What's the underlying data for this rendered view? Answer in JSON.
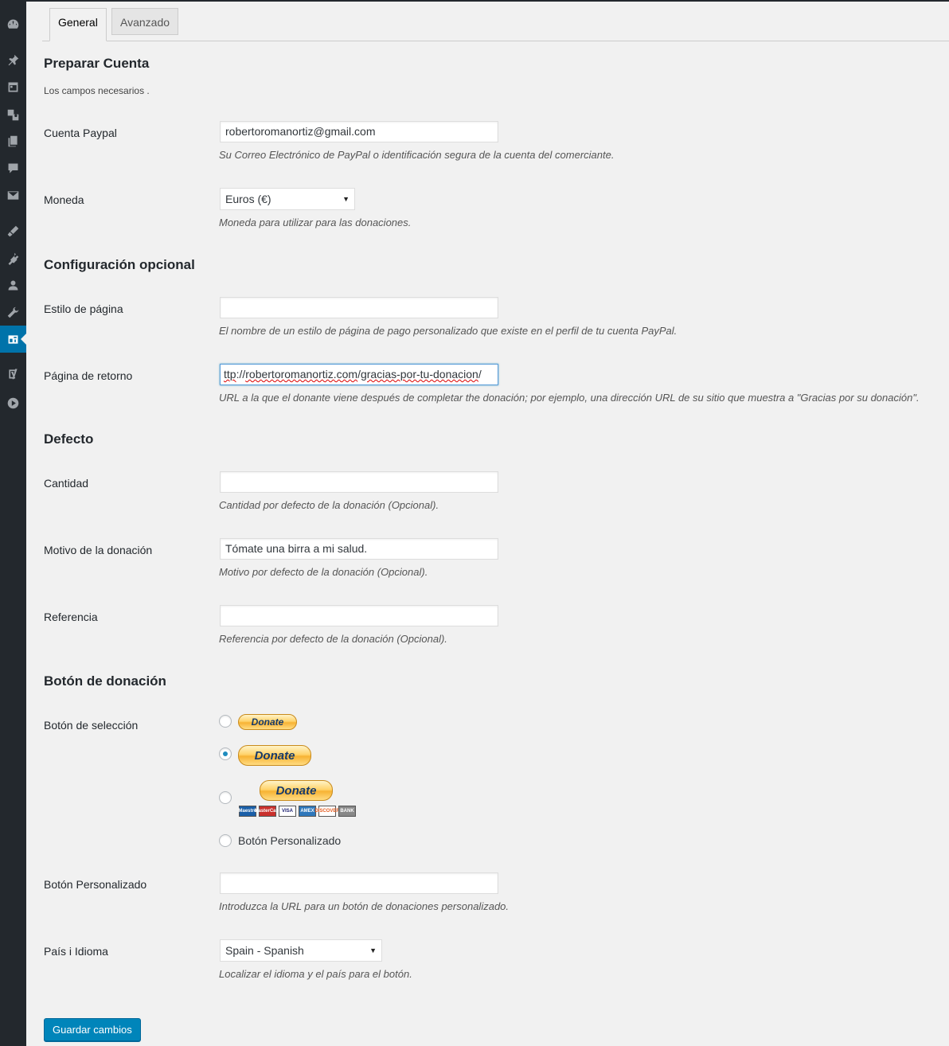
{
  "tabs": {
    "general": "General",
    "advanced": "Avanzado"
  },
  "sidebar": {
    "icons": [
      "dashboard-icon",
      "pin-icon",
      "calendar-icon",
      "media-icon",
      "pages-icon",
      "comments-icon",
      "mail-icon",
      "appearance-icon",
      "plugins-icon",
      "users-icon",
      "tools-icon",
      "donation-plugin-icon",
      "yoast-icon",
      "play-icon"
    ],
    "active": "donation-plugin-icon"
  },
  "account": {
    "title": "Preparar Cuenta",
    "intro": "Los campos necesarios .",
    "paypal_label": "Cuenta Paypal",
    "paypal_value": "robertoromanortiz@gmail.com",
    "paypal_desc": "Su Correo Electrónico de PayPal o identificación segura de la cuenta del comerciante.",
    "currency_label": "Moneda",
    "currency_value": "Euros (€)",
    "currency_desc": "Moneda para utilizar para las donaciones."
  },
  "optional": {
    "title": "Configuración opcional",
    "page_style_label": "Estilo de página",
    "page_style_value": "",
    "page_style_desc": "El nombre de un estilo de página de pago personalizado que existe en el perfil de tu cuenta PayPal.",
    "return_label": "Página de retorno",
    "return_value_prefix": "ttp",
    "return_value_sep1": "://",
    "return_value_domain": "robertoromanortiz.com",
    "return_value_sep2": "/",
    "return_value_path": "gracias-por-tu-donacion",
    "return_value_end": "/",
    "return_desc": "URL a la que el donante viene después de completar the donación; por ejemplo, una dirección URL de su sitio que muestra a \"Gracias por su donación\"."
  },
  "defaults": {
    "title": "Defecto",
    "amount_label": "Cantidad",
    "amount_value": "",
    "amount_desc": "Cantidad por defecto de la donación (Opcional).",
    "purpose_label": "Motivo de la donación",
    "purpose_value": "Tómate una birra a mi salud.",
    "purpose_desc": "Motivo por defecto de la donación (Opcional).",
    "reference_label": "Referencia",
    "reference_value": "",
    "reference_desc": "Referencia por defecto de la donación (Opcional)."
  },
  "button": {
    "title": "Botón de donación",
    "selection_label": "Botón de selección",
    "donate_text": "Donate",
    "cards": [
      "Maestro",
      "MasterCard",
      "VISA",
      "AMEX",
      "DISCOVER",
      "BANK"
    ],
    "selected_option": 2,
    "custom_option_label": "Botón Personalizado",
    "custom_label": "Botón Personalizado",
    "custom_value": "",
    "custom_desc": "Introduzca la URL para un botón de donaciones personalizado.",
    "country_label": "País i Idioma",
    "country_value": "Spain - Spanish",
    "country_desc": "Localizar el idioma y el país para el botón."
  },
  "actions": {
    "save_label": "Guardar cambios"
  },
  "colors": {
    "sidebar_bg": "#23282d",
    "accent": "#0073aa",
    "button": "#0085ba"
  }
}
